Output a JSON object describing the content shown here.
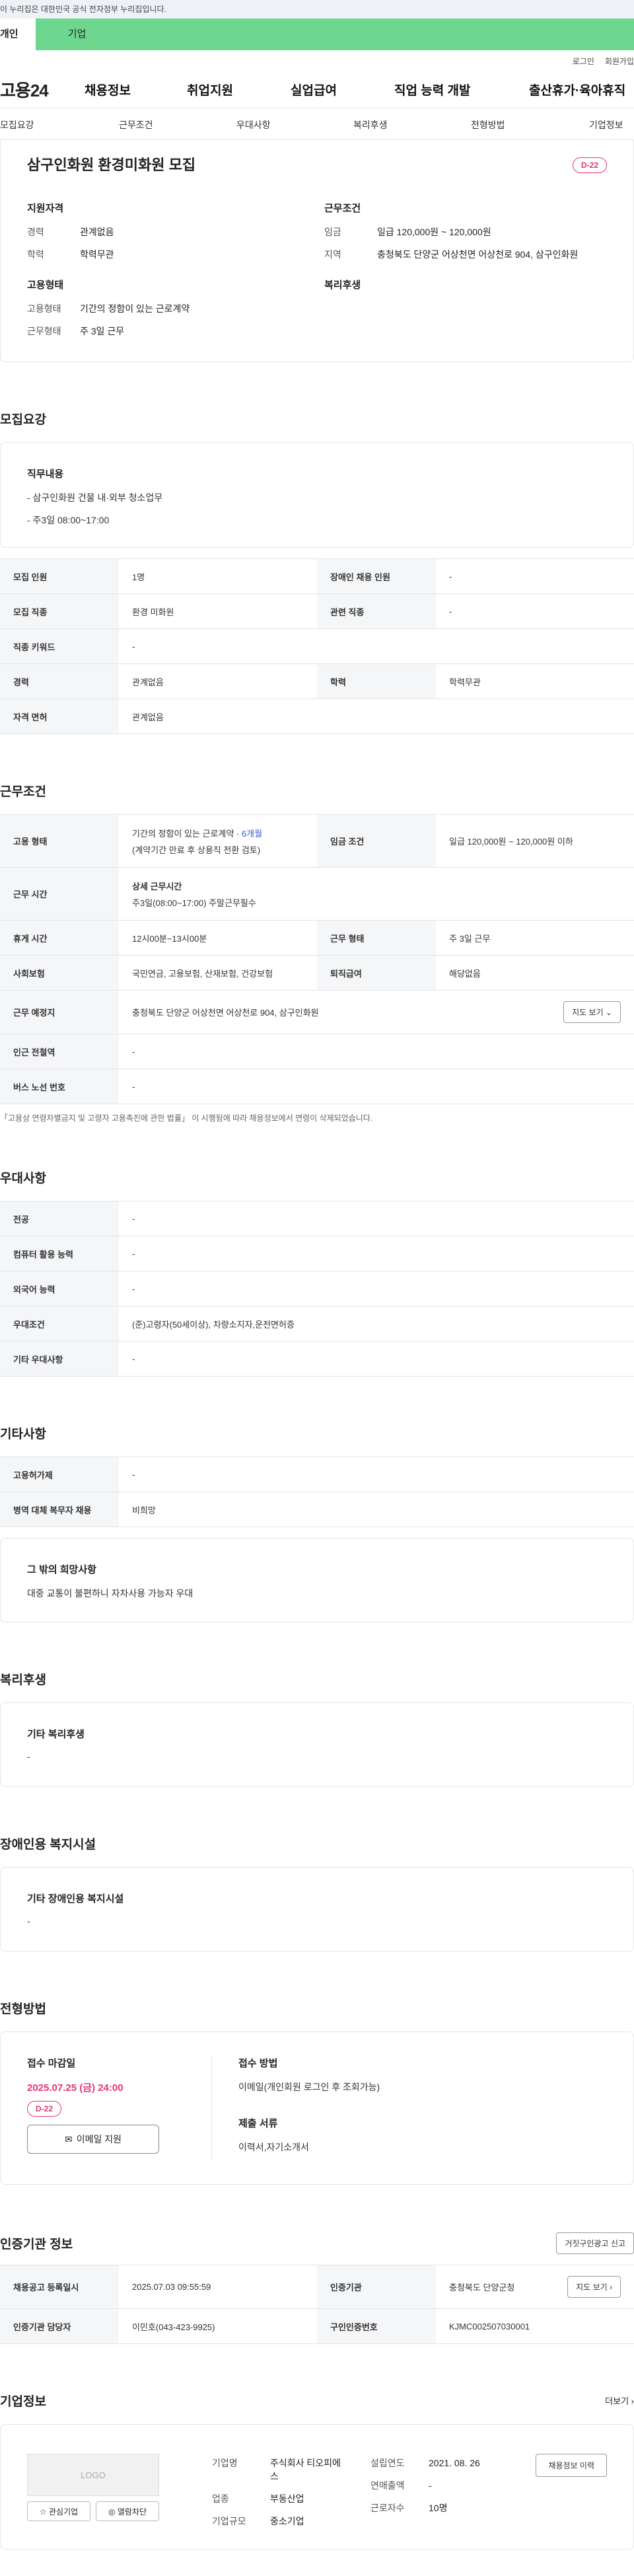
{
  "gov_banner": "이 누리집은 대한민국 공식 전자정부 누리집입니다.",
  "tabs": {
    "personal": "개인",
    "company": "기업"
  },
  "util": {
    "login": "로그인",
    "join": "회원가입"
  },
  "gnb": {
    "logo": "고용24",
    "items": [
      "채용정보",
      "취업지원",
      "실업급여",
      "직업 능력 개발",
      "출산휴가·육아휴직"
    ]
  },
  "anchor": [
    "모집요강",
    "근무조건",
    "우대사항",
    "복리후생",
    "전형방법",
    "기업정보"
  ],
  "summary": {
    "title": "삼구인화원 환경미화원 모집",
    "dday": "D-22",
    "qual": {
      "h": "지원자격",
      "rows": [
        [
          "경력",
          "관계없음"
        ],
        [
          "학력",
          "학력무관"
        ]
      ]
    },
    "emp": {
      "h": "고용형태",
      "rows": [
        [
          "고용형태",
          "기간의 정함이 있는 근로계약"
        ],
        [
          "근무형태",
          "주 3일 근무"
        ]
      ]
    },
    "cond": {
      "h": "근무조건",
      "rows": [
        [
          "임금",
          "일급 120,000원 ~ 120,000원"
        ],
        [
          "지역",
          "충청북도 단양군 어상천면 어상천로 904, 삼구인화원"
        ]
      ]
    },
    "welfare": {
      "h": "복리후생"
    }
  },
  "recruit": {
    "title": "모집요강",
    "job_h": "직무내용",
    "job_lines": [
      "- 삼구인화원 건물 내·외부 청소업무",
      "- 주3일 08:00~17:00"
    ],
    "rows": [
      [
        "모집 인원",
        "1명",
        "장애인 채용 인원",
        "-"
      ],
      [
        "모집 직종",
        "환경 미화원",
        "관련 직종",
        "-"
      ],
      [
        "직종 키워드",
        "-"
      ],
      [
        "경력",
        "관계없음",
        "학력",
        "학력무관"
      ],
      [
        "자격 면허",
        "관계없음"
      ]
    ]
  },
  "work": {
    "title": "근무조건",
    "emp_type_k": "고용 형태",
    "emp_type_v": "기간의 정함이 있는 근로계약 · ",
    "emp_period": "6개월",
    "emp_sub": "(계약기간 만료 후 상용직 전환 검토)",
    "wage_k": "임금 조건",
    "wage_v": "일급 120,000원 ~ 120,000원 이하",
    "hours_k": "근무 시간",
    "hours_h": "상세 근무시간",
    "hours_v": "주3일(08:00~17:00) 주말근무필수",
    "break_k": "휴게 시간",
    "break_v": "12시00분~13시00분",
    "form_k": "근무 형태",
    "form_v": "주 3일 근무",
    "ins_k": "사회보험",
    "ins_v": "국민연금, 고용보험, 산재보험, 건강보험",
    "sev_k": "퇴직급여",
    "sev_v": "해당없음",
    "loc_k": "근무 예정지",
    "loc_v": "충청북도 단양군 어상천면 어상천로 904, 삼구인화원",
    "map_btn": "지도 보기 ⌄",
    "sub_k": "인근 전철역",
    "sub_v": "-",
    "bus_k": "버스 노선 번호",
    "bus_v": "-",
    "note": "「고용상 연령차별금지 및 고령자 고용촉진에 관한 법률」 이 시행됨에 따라 채용정보에서 연령이 삭제되었습니다."
  },
  "pref": {
    "title": "우대사항",
    "rows": [
      [
        "전공",
        "-"
      ],
      [
        "컴퓨터 활용 능력",
        "-"
      ],
      [
        "외국어 능력",
        "-"
      ],
      [
        "우대조건",
        "(준)고령자(50세이상), 차량소지자,운전면허증"
      ],
      [
        "기타 우대사항",
        "-"
      ]
    ]
  },
  "etc": {
    "title": "기타사항",
    "rows": [
      [
        "고용허가제",
        "-"
      ],
      [
        "병역 대체 복무자 채용",
        "비희망"
      ]
    ],
    "box_h": "그 밖의 희망사항",
    "box_v": "대중 교통이 불편하니 자차사용 가능자 우대"
  },
  "benefit": {
    "title": "복리후생",
    "h": "기타 복리후생",
    "v": "-"
  },
  "disab": {
    "title": "장애인용 복지시설",
    "h": "기타 장애인용 복지시설",
    "v": "-"
  },
  "process": {
    "title": "전형방법",
    "deadline_h": "접수 마감일",
    "deadline": "2025.07.25 (금) 24:00",
    "dday": "D-22",
    "apply_btn": "이메일 지원",
    "method_h": "접수 방법",
    "method_v": "이메일(개인회원 로그인 후 조회가능)",
    "docs_h": "제출 서류",
    "docs_v": "이력서,자기소개서"
  },
  "cert": {
    "title": "인증기관 정보",
    "report_btn": "거짓구인광고 신고",
    "r1": [
      "채용공고 등록일시",
      "2025.07.03 09:55:59",
      "인증기관",
      "충청북도 단양군청"
    ],
    "r2": [
      "인증기관 담당자",
      "이민호(043-423-9925)",
      "구인인증번호",
      "KJMC002507030001"
    ],
    "map_btn": "지도 보기 ›"
  },
  "company": {
    "title": "기업정보",
    "more": "더보기 ›",
    "logo": "LOGO",
    "fav": "☆ 관심기업",
    "block": "◎ 열람차단",
    "name_k": "기업명",
    "name_v": "주식회사 티오피에스",
    "ind_k": "업종",
    "ind_v": "부동산업",
    "size_k": "기업규모",
    "size_v": "중소기업",
    "est_k": "설립연도",
    "est_v": "2021. 08. 26",
    "sales_k": "연매출액",
    "sales_v": "-",
    "emp_k": "근로자수",
    "emp_v": "10명",
    "jobs_btn": "채용정보 이력"
  }
}
